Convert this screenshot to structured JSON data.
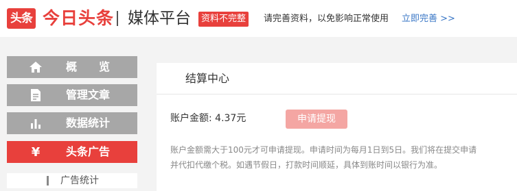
{
  "header": {
    "logo_icon_text": "头条",
    "logo_text": "今日头条",
    "platform_title": "媒体平台",
    "warn_badge": "资料不完整",
    "notice": "请完善资料，以免影响正常使用",
    "complete_link": "立即完善 >>"
  },
  "sidebar": {
    "items": [
      {
        "label": "概　　览",
        "icon": "home-icon"
      },
      {
        "label": "管理文章",
        "icon": "document-icon"
      },
      {
        "label": "数据统计",
        "icon": "bar-chart-icon"
      },
      {
        "label": "头条广告",
        "icon": "yen-icon"
      }
    ],
    "active": "头条广告",
    "sub_items": [
      {
        "label": "广告统计"
      }
    ]
  },
  "main": {
    "title": "结算中心",
    "balance_label": "账户金额: 4.37元",
    "withdraw_button": "申请提现",
    "note_line1": "账户金额需大于100元才可申请提现。申请时间为每月1日到5日。我们将在提交申请",
    "note_line2": "并代扣代缴个税。如遇节假日，打款时间顺延，具体到账时间以银行为准。"
  },
  "colors": {
    "brand": "#e8403c",
    "sidebar_inactive": "#a7a7a7",
    "link": "#3a77c6",
    "button_disabled": "#f4a6a3"
  }
}
